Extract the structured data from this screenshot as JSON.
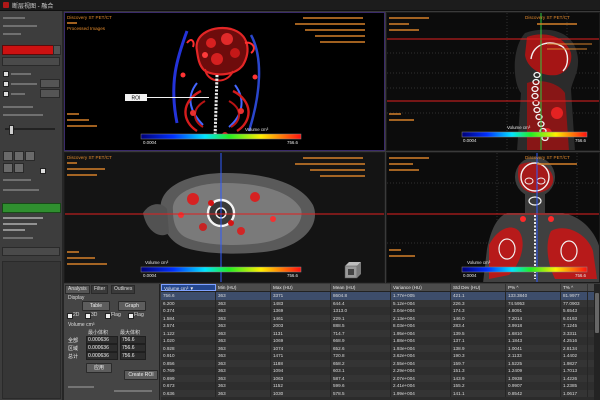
{
  "window": {
    "title": "断层视图 - 融合"
  },
  "colors": {
    "accent_red": "#cc1111",
    "panel_green": "#2f8f2f",
    "crosshair_blue": "#2f5bff",
    "crosshair_red": "#e02020",
    "crosshair_green": "#2ecc40",
    "overlay_text": "#e2892b"
  },
  "viewports": {
    "volume_3d": {
      "info_top_left": [
        "Discovery ST PET/CT",
        "Processed Images"
      ],
      "roi_label": "ROI",
      "colorbar": {
        "label": "Volume cm³",
        "min": "0.0004",
        "max": "756.6"
      }
    },
    "sagittal": {
      "info_top_left": [
        "Discovery ST PET/CT"
      ],
      "colorbar": {
        "label": "Volume cm³",
        "min": "0.0004",
        "max": "756.6"
      }
    },
    "axial": {
      "info_top_left": [
        "Discovery ST PET/CT"
      ],
      "colorbar": {
        "label": "Volume cm³",
        "min": "0.0004",
        "max": "756.6"
      }
    },
    "coronal": {
      "info_top_left": [
        "Discovery ST PET/CT"
      ],
      "colorbar": {
        "label": "Volume cm³",
        "min": "0.0004",
        "max": "756.6"
      }
    }
  },
  "analysis": {
    "tabs": [
      "Analysis",
      "Filter",
      "Outlines"
    ],
    "display_label": "Display",
    "table_button": "Table",
    "graph_button": "Graph",
    "checkboxes": [
      "2D",
      "3D",
      "Flag",
      "Flag"
    ],
    "volume_label": "Volume cm³",
    "col_min": "最小体积",
    "col_max": "最大体积",
    "rows": [
      {
        "label": "全部",
        "min": "0.000636",
        "max": "756.6"
      },
      {
        "label": "区域",
        "min": "0.000636",
        "max": "756.6"
      },
      {
        "label": "总计",
        "min": "0.000636",
        "max": "756.6"
      }
    ],
    "apply_button": "应用",
    "create_roi_button": "Create ROI"
  },
  "table": {
    "headers": [
      "Volume cm³ ▼",
      "Min (HU)",
      "Max (HU)",
      "Mean (HU)",
      "Variance (HU)",
      "Std Dev (HU)",
      "P% ^",
      "T% ^"
    ],
    "rows": [
      [
        "756.6",
        "363",
        "3371",
        "8604.8",
        "1.77e+005",
        "421.1",
        "133.3840",
        "81.9977"
      ],
      [
        "6.200",
        "363",
        "1483",
        "644.4",
        "5.12e+004",
        "226.3",
        "74.5953",
        "77.0903"
      ],
      [
        "0.374",
        "363",
        "1369",
        "1313.0",
        "3.04e+004",
        "174.3",
        "4.8091",
        "5.6543"
      ],
      [
        "1.584",
        "363",
        "1461",
        "229.1",
        "2.13e+004",
        "146.0",
        "7.2014",
        "6.0193"
      ],
      [
        "3.574",
        "363",
        "2003",
        "888.5",
        "8.03e+004",
        "283.4",
        "3.9918",
        "7.1245"
      ],
      [
        "1.122",
        "363",
        "1131",
        "714.7",
        "1.95e+004",
        "139.5",
        "1.6810",
        "3.3311"
      ],
      [
        "1.020",
        "363",
        "1069",
        "668.9",
        "1.88e+004",
        "137.1",
        "1.1843",
        "4.2516"
      ],
      [
        "0.928",
        "363",
        "1074",
        "652.6",
        "1.93e+004",
        "138.9",
        "1.0041",
        "2.8134"
      ],
      [
        "0.910",
        "363",
        "1471",
        "720.8",
        "3.62e+004",
        "190.3",
        "2.1133",
        "1.4402"
      ],
      [
        "0.856",
        "363",
        "1188",
        "658.2",
        "2.55e+004",
        "159.7",
        "1.5225",
        "1.9827"
      ],
      [
        "0.769",
        "363",
        "1094",
        "603.1",
        "2.29e+004",
        "151.3",
        "1.2409",
        "1.7013"
      ],
      [
        "0.699",
        "363",
        "1063",
        "587.4",
        "2.07e+004",
        "143.9",
        "1.0938",
        "1.4226"
      ],
      [
        "0.673",
        "363",
        "1152",
        "599.6",
        "2.41e+004",
        "155.2",
        "0.9907",
        "1.2385"
      ],
      [
        "0.636",
        "363",
        "1030",
        "578.5",
        "1.99e+004",
        "141.1",
        "0.8542",
        "1.0617"
      ]
    ]
  }
}
